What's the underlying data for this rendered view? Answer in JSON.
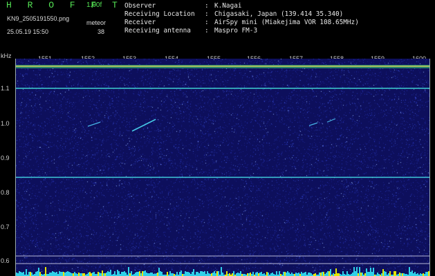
{
  "header": {
    "app_title": "H R O F F T",
    "version": "1.00f",
    "filename": "KN9_2505191550.png",
    "datetime": "25.05.19 15:50",
    "meteor_label": "meteor",
    "meteor_count": "38"
  },
  "info": [
    {
      "key": "Observer",
      "sep": ":",
      "value": "K.Nagai"
    },
    {
      "key": "Receiving Location",
      "sep": ":",
      "value": "Chigasaki, Japan (139.414 35.340)"
    },
    {
      "key": "Receiver",
      "sep": ":",
      "value": "AirSpy mini (Miakejima VOR 108.65MHz)"
    },
    {
      "key": "Receiving antenna",
      "sep": ":",
      "value": "Maspro FM-3"
    }
  ],
  "axes": {
    "y_unit": "kHz",
    "y_ticks": [
      "1.1",
      "1.0",
      "0.9",
      "0.8",
      "0.7",
      "0.6"
    ],
    "x_ticks": [
      "1551",
      "1552",
      "1553",
      "1554",
      "1555",
      "1556",
      "1557",
      "1558",
      "1559",
      "1600"
    ]
  },
  "colors": {
    "background": "#000000",
    "title_green": "#55e455",
    "spectrogram_base": "#0d0f5c",
    "carrier_cyan": "#3fd0d0",
    "level_yellow": "#e6e600"
  }
}
